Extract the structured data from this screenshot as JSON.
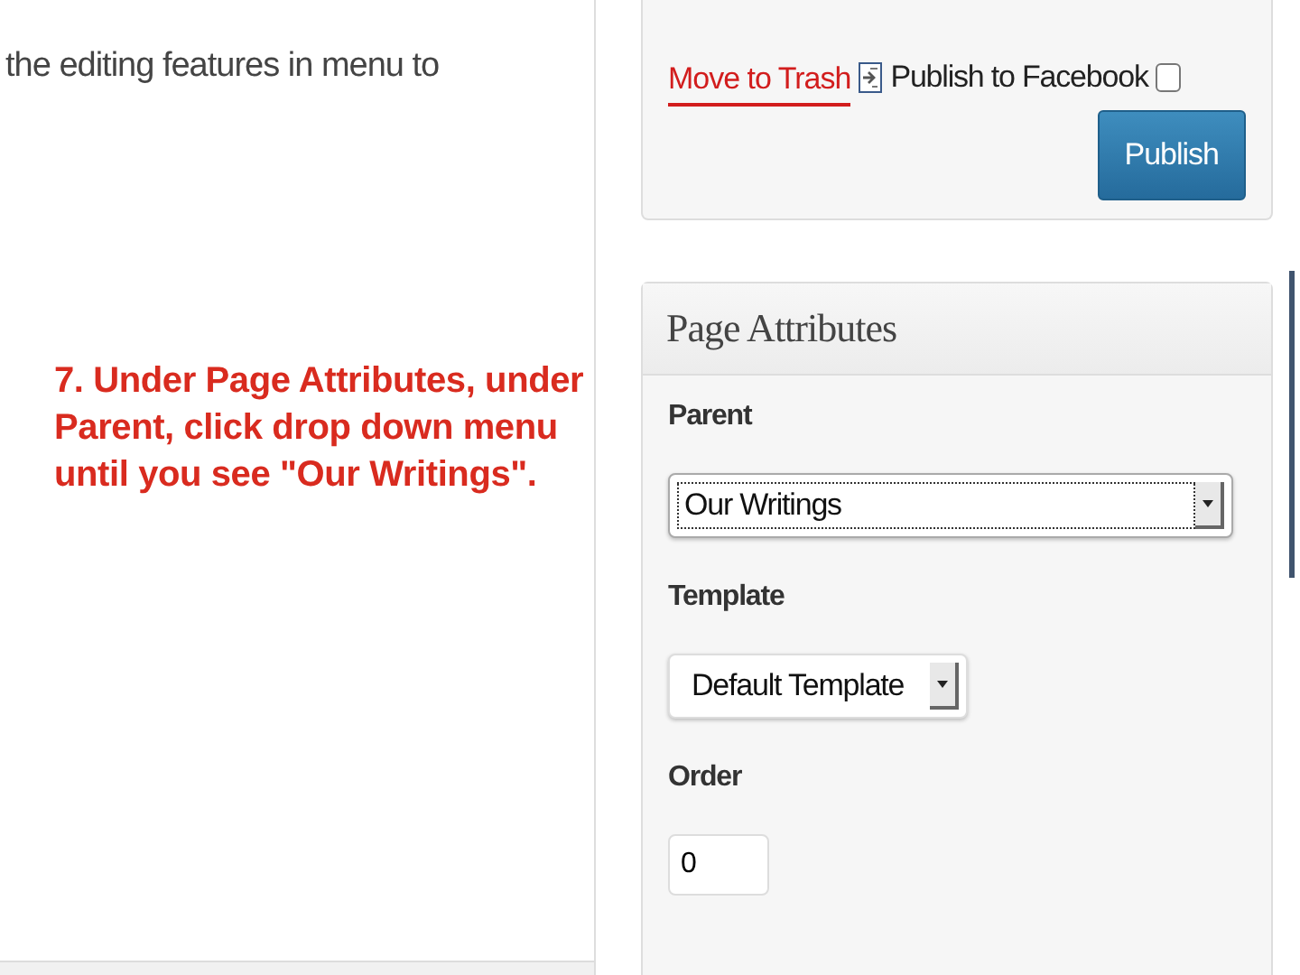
{
  "editor_text": "the editing features in menu to",
  "annotation": "7. Under Page Attributes, under Parent, click drop down menu until you see \"Our Writings\".",
  "publish_box": {
    "trash_link": "Move to Trash",
    "facebook_label": "Publish to Facebook",
    "facebook_checked": false,
    "publish_button": "Publish"
  },
  "page_attributes": {
    "title": "Page Attributes",
    "parent": {
      "label": "Parent",
      "value": "Our Writings",
      "focused": true
    },
    "template": {
      "label": "Template",
      "value": "Default Template"
    },
    "order": {
      "label": "Order",
      "value": "0"
    }
  }
}
